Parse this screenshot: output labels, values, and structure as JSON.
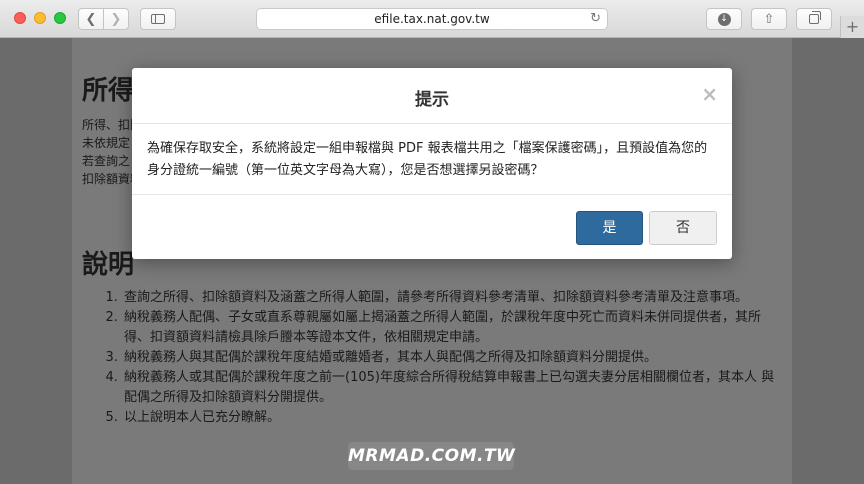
{
  "browser": {
    "url": "efile.tax.nat.gov.tw",
    "newtab_label": "+"
  },
  "page": {
    "title": "所得、扣除額資料",
    "para_lines": [
      "所得、扣除額",
      "未依規定",
      "若查詢之",
      "扣除額資料"
    ],
    "section_title": "說明",
    "notes": [
      "查詢之所得、扣除額資料及涵蓋之所得人範圍，請參考所得資料參考清單、扣除額資料參考清單及注意事項。",
      "納稅義務人配偶、子女或直系尊親屬如屬上揭涵蓋之所得人範圍，於課稅年度中死亡而資料未併同提供者，其所 得、扣資額資料請檢具除戶謄本等證本文件，依相關規定申請。",
      "納稅義務人與其配偶於課稅年度結婚或離婚者，其本人與配偶之所得及扣除額資料分開提供。",
      "納稅義務人或其配偶於課稅年度之前一(105)年度綜合所得稅結算申報書上已勾選夫妻分居相關欄位者，其本人 與配偶之所得及扣除額資料分開提供。",
      "以上說明本人已充分瞭解。"
    ]
  },
  "modal": {
    "title": "提示",
    "close": "×",
    "message": "為確保存取安全，系統將設定一組申報檔與 PDF 報表檔共用之「檔案保護密碼」，且預設值為您的身分證統一編號（第一位英文字母為大寫），您是否想選擇另設密碼？",
    "yes_label": "是",
    "no_label": "否"
  },
  "watermark": "MRMAD.COM.TW",
  "colors": {
    "primary_button": "#2f6a9e",
    "overlay": "#6b6b6b"
  }
}
